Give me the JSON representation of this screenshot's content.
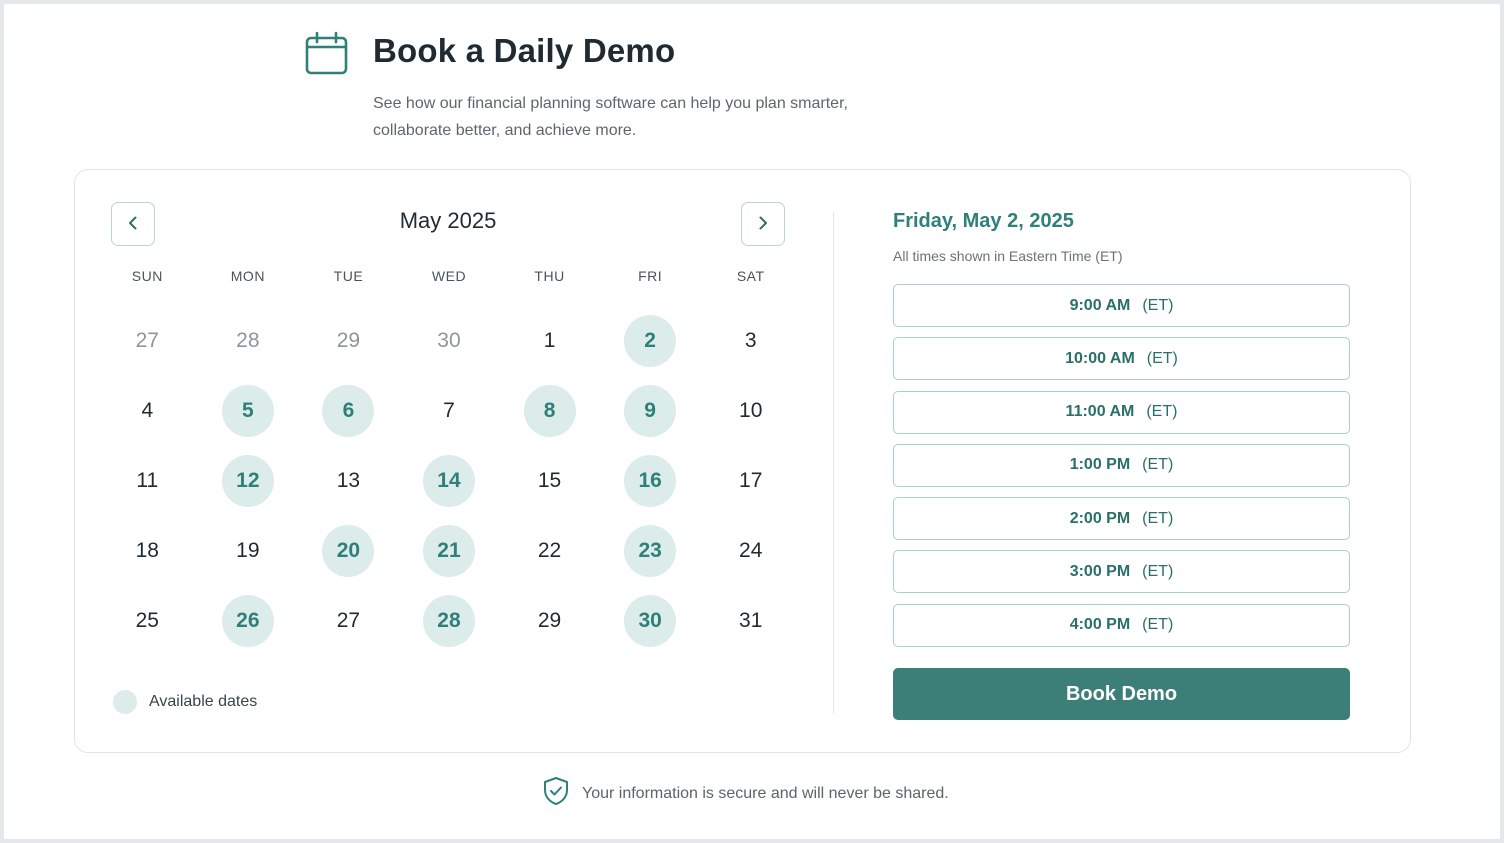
{
  "header": {
    "title": "Book a Daily Demo",
    "subtitle_line1": "See how our financial planning software can help you plan smarter,",
    "subtitle_line2": "collaborate better, and achieve more.",
    "icon": "calendar-icon"
  },
  "calendar": {
    "month_label": "May 2025",
    "prev_icon": "chevron-left-icon",
    "next_icon": "chevron-right-icon",
    "weekdays": [
      "SUN",
      "MON",
      "TUE",
      "WED",
      "THU",
      "FRI",
      "SAT"
    ],
    "days": [
      {
        "label": "27",
        "state": "other"
      },
      {
        "label": "28",
        "state": "other"
      },
      {
        "label": "29",
        "state": "other"
      },
      {
        "label": "30",
        "state": "other"
      },
      {
        "label": "1",
        "state": "normal"
      },
      {
        "label": "2",
        "state": "available"
      },
      {
        "label": "3",
        "state": "normal"
      },
      {
        "label": "4",
        "state": "normal"
      },
      {
        "label": "5",
        "state": "available"
      },
      {
        "label": "6",
        "state": "available"
      },
      {
        "label": "7",
        "state": "normal"
      },
      {
        "label": "8",
        "state": "available"
      },
      {
        "label": "9",
        "state": "available"
      },
      {
        "label": "10",
        "state": "normal"
      },
      {
        "label": "11",
        "state": "normal"
      },
      {
        "label": "12",
        "state": "available"
      },
      {
        "label": "13",
        "state": "normal"
      },
      {
        "label": "14",
        "state": "available"
      },
      {
        "label": "15",
        "state": "normal"
      },
      {
        "label": "16",
        "state": "available"
      },
      {
        "label": "17",
        "state": "normal"
      },
      {
        "label": "18",
        "state": "normal"
      },
      {
        "label": "19",
        "state": "normal"
      },
      {
        "label": "20",
        "state": "available"
      },
      {
        "label": "21",
        "state": "available"
      },
      {
        "label": "22",
        "state": "normal"
      },
      {
        "label": "23",
        "state": "available"
      },
      {
        "label": "24",
        "state": "normal"
      },
      {
        "label": "25",
        "state": "normal"
      },
      {
        "label": "26",
        "state": "available"
      },
      {
        "label": "27",
        "state": "normal"
      },
      {
        "label": "28",
        "state": "available"
      },
      {
        "label": "29",
        "state": "normal"
      },
      {
        "label": "30",
        "state": "available"
      },
      {
        "label": "31",
        "state": "normal"
      }
    ],
    "legend_label": "Available dates"
  },
  "booking": {
    "selected_date": "Friday, May 2, 2025",
    "timezone_note": "All times shown in Eastern Time (ET)",
    "slots": [
      {
        "time": "9:00 AM",
        "zone": "(ET)"
      },
      {
        "time": "10:00 AM",
        "zone": "(ET)"
      },
      {
        "time": "11:00 AM",
        "zone": "(ET)"
      },
      {
        "time": "1:00 PM",
        "zone": "(ET)"
      },
      {
        "time": "2:00 PM",
        "zone": "(ET)"
      },
      {
        "time": "3:00 PM",
        "zone": "(ET)"
      },
      {
        "time": "4:00 PM",
        "zone": "(ET)"
      }
    ],
    "book_label": "Book Demo"
  },
  "footer": {
    "secure_text": "Your information is secure and will never be shared.",
    "icon": "shield-check-icon"
  },
  "colors": {
    "accent": "#2f7f7a",
    "button": "#3c7f79",
    "available_bg": "#dcecea"
  }
}
